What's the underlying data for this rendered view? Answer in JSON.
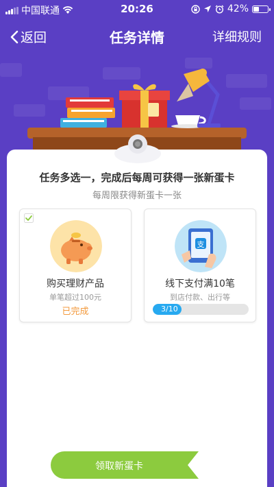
{
  "status_bar": {
    "carrier": "中国联通",
    "time": "20:26",
    "battery": "42%",
    "battery_level": 0.42
  },
  "nav": {
    "back_label": "返回",
    "title": "任务详情",
    "rules_label": "详细规则"
  },
  "card": {
    "title": "任务多选一，完成后每周可获得一张新蛋卡",
    "subtitle": "每周限获得新蛋卡一张"
  },
  "tasks": [
    {
      "name": "购买理财产品",
      "desc": "单笔超过100元",
      "status": "已完成",
      "completed": true,
      "icon": "piggy-bank-icon"
    },
    {
      "name": "线下支付满10笔",
      "desc": "到店付款、出行等",
      "progress_text": "3/10",
      "progress_value": 3,
      "progress_max": 10,
      "completed": false,
      "icon": "alipay-tablet-icon"
    }
  ],
  "claim_button": {
    "label": "领取新蛋卡"
  },
  "colors": {
    "background": "#5a3fc4",
    "accent_green": "#8ccb3e",
    "progress_blue": "#27a9f0",
    "status_orange": "#f39a3d"
  }
}
